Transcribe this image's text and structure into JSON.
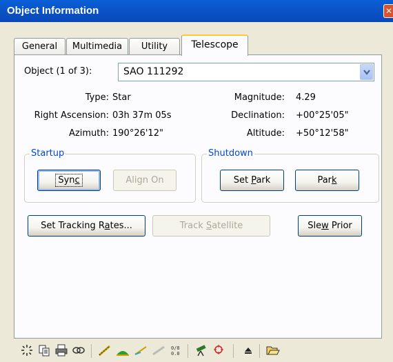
{
  "window": {
    "title": "Object Information",
    "close_glyph": "✕"
  },
  "tabs": [
    {
      "label": "General",
      "active": false
    },
    {
      "label": "Multimedia",
      "active": false
    },
    {
      "label": "Utility",
      "active": false
    },
    {
      "label": "Telescope",
      "active": true
    }
  ],
  "object": {
    "label": "Object (1 of 3):",
    "selected": "SAO 111292"
  },
  "info": {
    "type_label": "Type:",
    "type_value": "Star",
    "ra_label": "Right Ascension:",
    "ra_value": "03h 37m 05s",
    "azimuth_label": "Azimuth:",
    "azimuth_value": "190°26'12\"",
    "magnitude_label": "Magnitude:",
    "magnitude_value": "4.29",
    "declination_label": "Declination:",
    "declination_value": "+00°25'05\"",
    "altitude_label": "Altitude:",
    "altitude_value": "+50°12'58\""
  },
  "startup": {
    "title": "Startup",
    "sync": {
      "pre": "Syn",
      "u": "c",
      "post": ""
    },
    "align_on": "Align On"
  },
  "shutdown": {
    "title": "Shutdown",
    "set_park": {
      "pre": "Set ",
      "u": "P",
      "post": "ark"
    },
    "park": {
      "pre": "Par",
      "u": "k",
      "post": ""
    }
  },
  "actions": {
    "set_tracking": {
      "pre": "Set Tracking R",
      "u": "a",
      "post": "tes..."
    },
    "track_satellite": {
      "pre": "Track ",
      "u": "S",
      "post": "atellite"
    },
    "slew_prior": {
      "pre": "Sle",
      "u": "w",
      "post": " Prior"
    }
  },
  "toolbar_icons": [
    "center-target-icon",
    "copy-icon",
    "print-icon",
    "link-icon",
    "telescope-path-icon",
    "horizon-icon",
    "laser-icon",
    "dim-icon",
    "data-table-icon",
    "telescope-icon",
    "crosshair-icon",
    "up-arrow-icon",
    "open-folder-icon"
  ]
}
